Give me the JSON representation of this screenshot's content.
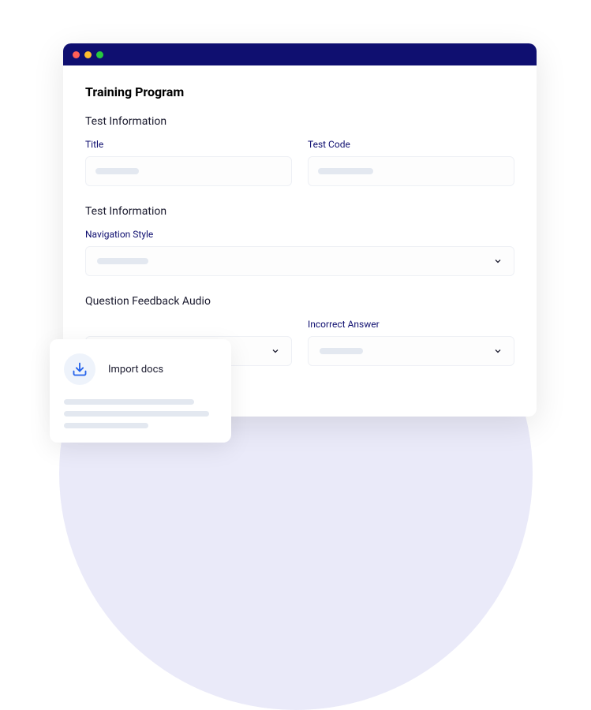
{
  "page": {
    "title": "Training Program"
  },
  "sections": {
    "testInfo1": {
      "title": "Test Information",
      "fields": {
        "title": {
          "label": "Title"
        },
        "testCode": {
          "label": "Test Code"
        }
      }
    },
    "testInfo2": {
      "title": "Test Information",
      "fields": {
        "navStyle": {
          "label": "Navigation Style"
        }
      }
    },
    "feedbackAudio": {
      "title": "Question Feedback Audio",
      "fields": {
        "incorrect": {
          "label": "Incorrect Answer"
        }
      }
    }
  },
  "importCard": {
    "title": "Import docs"
  }
}
